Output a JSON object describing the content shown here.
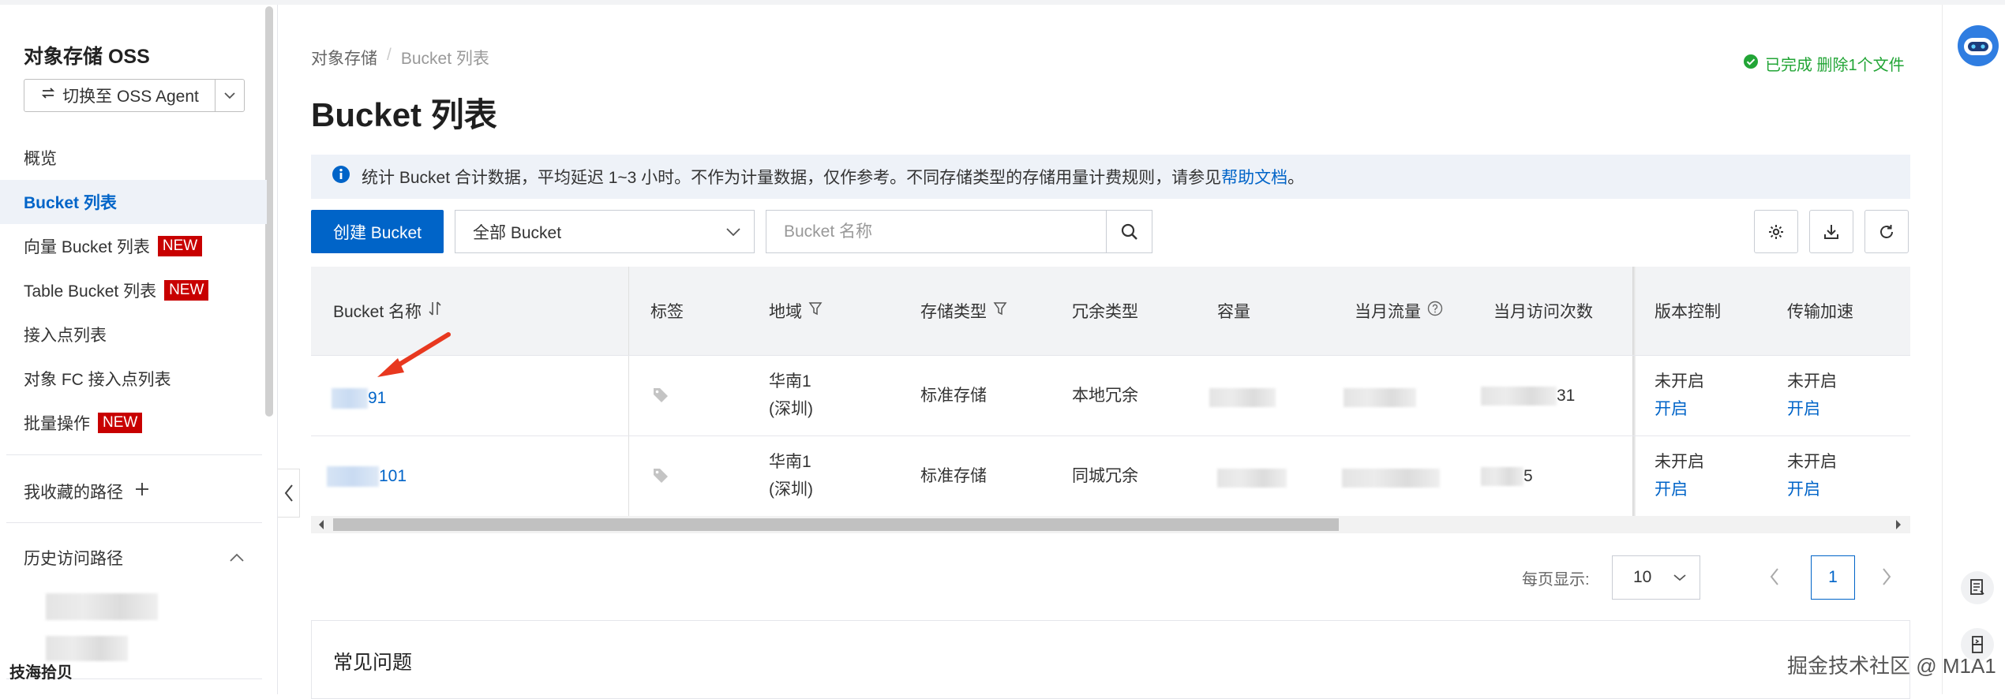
{
  "sidebar": {
    "title": "对象存储 OSS",
    "agent_button": "切换至 OSS Agent",
    "nav": [
      {
        "label": "概览",
        "badge": ""
      },
      {
        "label": "Bucket 列表",
        "badge": ""
      },
      {
        "label": "向量 Bucket 列表",
        "badge": "NEW"
      },
      {
        "label": "Table Bucket 列表",
        "badge": "NEW"
      },
      {
        "label": "接入点列表",
        "badge": ""
      },
      {
        "label": "对象 FC 接入点列表",
        "badge": ""
      },
      {
        "label": "批量操作",
        "badge": "NEW"
      }
    ],
    "favorites_label": "我收藏的路径",
    "history_label": "历史访问路径"
  },
  "watermark_left": "技海拾贝",
  "breadcrumb": {
    "root": "对象存储",
    "sep": "/",
    "current": "Bucket 列表"
  },
  "page_title": "Bucket 列表",
  "status": {
    "text": "已完成 删除1个文件",
    "color": "#22a536"
  },
  "info_bar": {
    "text": "统计 Bucket 合计数据，平均延迟 1~3 小时。不作为计量数据，仅作参考。不同存储类型的存储用量计费规则，请参见",
    "link": "帮助文档",
    "suffix": "。"
  },
  "toolbar": {
    "create_label": "创建 Bucket",
    "filter_value": "全部 Bucket",
    "search_placeholder": "Bucket 名称"
  },
  "table": {
    "headers": {
      "name": "Bucket 名称",
      "tags": "标签",
      "region": "地域",
      "storage": "存储类型",
      "redundancy": "冗余类型",
      "capacity": "容量",
      "traffic": "当月流量",
      "visits": "当月访问次数",
      "versioning": "版本控制",
      "acceleration": "传输加速"
    },
    "rows": [
      {
        "name": "91",
        "region_line1": "华南1",
        "region_line2": "(深圳)",
        "storage": "标准存储",
        "redundancy": "本地冗余",
        "visits": "31",
        "versioning_status": "未开启",
        "versioning_action": "开启",
        "accel_status": "未开启",
        "accel_action": "开启"
      },
      {
        "name": "101",
        "region_line1": "华南1",
        "region_line2": "(深圳)",
        "storage": "标准存储",
        "redundancy": "同城冗余",
        "visits": "5",
        "versioning_status": "未开启",
        "versioning_action": "开启",
        "accel_status": "未开启",
        "accel_action": "开启"
      }
    ]
  },
  "pagination": {
    "per_page_label": "每页显示:",
    "per_page": "10",
    "current_page": "1"
  },
  "faq_title": "常见问题",
  "watermark_right": "掘金技术社区 @ M1A1",
  "colors": {
    "primary": "#0064c8",
    "badge_red": "#c80000",
    "arrow": "#e8381f"
  }
}
